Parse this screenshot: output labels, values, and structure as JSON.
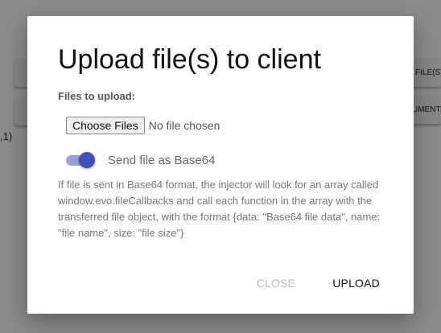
{
  "background": {
    "buttons": [
      {
        "label": ""
      },
      {
        "label": ""
      },
      {
        "label": "FILE(S)"
      },
      {
        "label": "UMENT"
      }
    ],
    "side_text": ",1)"
  },
  "dialog": {
    "title": "Upload file(s) to client",
    "files_label": "Files to upload:",
    "choose_files_label": "Choose Files",
    "no_file_text": "No file chosen",
    "toggle": {
      "label": "Send file as Base64",
      "checked": true,
      "color": "#3f51b5"
    },
    "help_text": "If file is sent in Base64 format, the injector will look for an array called window.evo.fileCallbacks and call each function in the array with the transferred file object, with the format {data: \"Base64 file data\", name: \"file name\", size: \"file size\"}",
    "actions": {
      "close_label": "CLOSE",
      "upload_label": "UPLOAD"
    }
  }
}
